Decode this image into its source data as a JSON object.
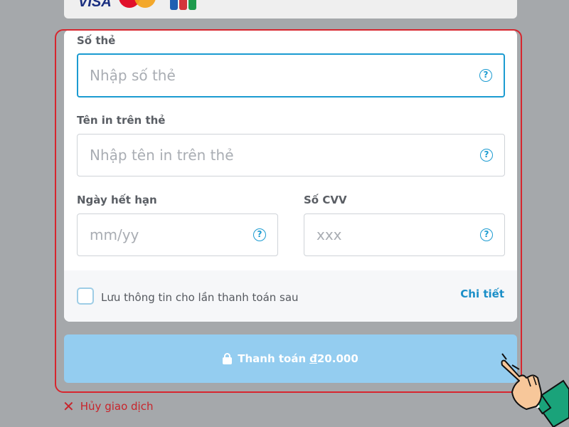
{
  "card_brands": {
    "visa": "VISA",
    "mastercard": "Mastercard",
    "jcb": "JCB"
  },
  "card_number": {
    "label": "Số thẻ",
    "placeholder": "Nhập số thẻ",
    "help_icon": "question-circle-icon",
    "help_symbol": "?"
  },
  "card_name": {
    "label": "Tên in trên thẻ",
    "placeholder": "Nhập tên in trên thẻ",
    "help_symbol": "?"
  },
  "expiry": {
    "label": "Ngày hết hạn",
    "placeholder": "mm/yy",
    "help_symbol": "?"
  },
  "cvv": {
    "label": "Số CVV",
    "placeholder": "xxx",
    "help_symbol": "?"
  },
  "save_info": {
    "label": "Lưu thông tin cho lần thanh toán sau",
    "checked": false,
    "details_link": "Chi tiết"
  },
  "pay_button": {
    "label": "Thanh toán",
    "currency_symbol": "đ",
    "amount": "20.000",
    "icon": "lock-icon"
  },
  "cancel": {
    "label": "Hủy giao dịch",
    "icon": "close-icon"
  },
  "colors": {
    "accent": "#1b9bd1",
    "highlight": "#d7262e",
    "pay_button": "#94cdf0",
    "cancel": "#c8242b"
  }
}
